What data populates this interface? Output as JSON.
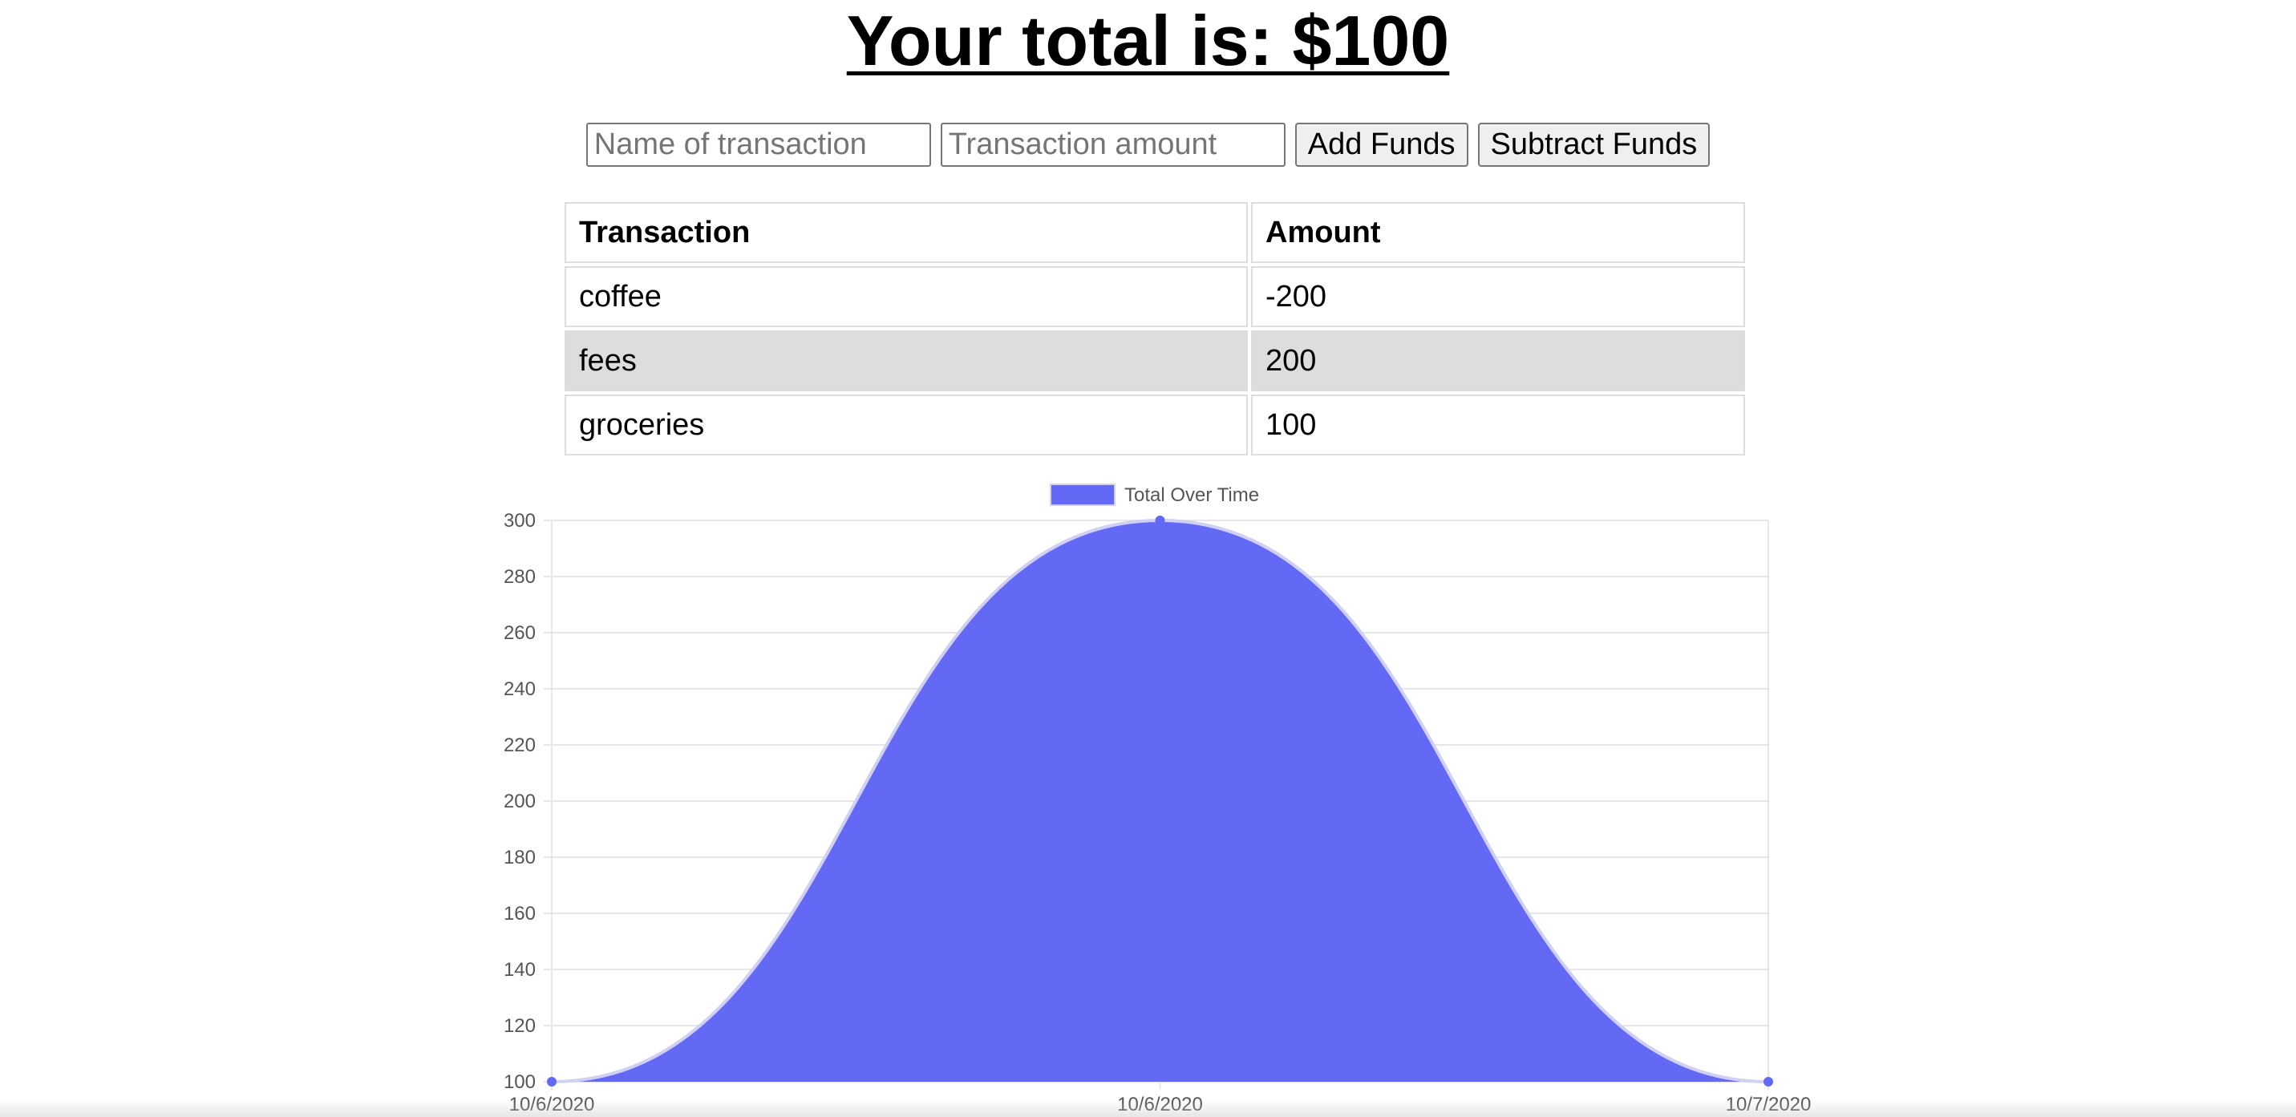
{
  "header": {
    "total_text": "Your total is: $100"
  },
  "form": {
    "name_placeholder": "Name of transaction",
    "amount_placeholder": "Transaction amount",
    "add_label": "Add Funds",
    "subtract_label": "Subtract Funds"
  },
  "table": {
    "headers": [
      "Transaction",
      "Amount"
    ],
    "rows": [
      {
        "name": "coffee",
        "amount": "-200"
      },
      {
        "name": "fees",
        "amount": "200"
      },
      {
        "name": "groceries",
        "amount": "100"
      }
    ]
  },
  "chart_data": {
    "type": "area",
    "x": [
      "10/6/2020",
      "10/6/2020",
      "10/7/2020"
    ],
    "series": [
      {
        "name": "Total Over Time",
        "values": [
          100,
          300,
          100
        ]
      }
    ],
    "ylim": [
      100,
      300
    ],
    "y_ticks": [
      100,
      120,
      140,
      160,
      180,
      200,
      220,
      240,
      260,
      280,
      300
    ],
    "grid": true,
    "legend_position": "top",
    "colors": {
      "fill": "#6369f5",
      "line": "#cfd0f4",
      "grid": "#e6e6e6",
      "point": "#6369f5"
    }
  }
}
